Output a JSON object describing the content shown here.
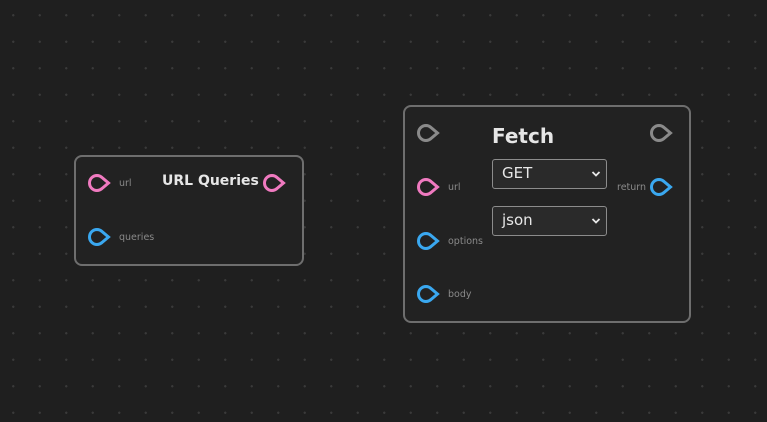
{
  "nodes": {
    "url_queries": {
      "title": "URL Queries",
      "inputs": {
        "url": "url",
        "queries": "queries"
      }
    },
    "fetch": {
      "title": "Fetch",
      "inputs": {
        "url": "url",
        "options": "options",
        "body": "body"
      },
      "outputs": {
        "return": "return"
      },
      "method": {
        "value": "GET"
      },
      "response_type": {
        "value": "json"
      }
    }
  },
  "colors": {
    "background": "#1f1f1f",
    "grid_dot": "#3a3a3a",
    "node_border": "#6e6e6e",
    "port_string": "#f07ac0",
    "port_object": "#3aa8f0",
    "port_exec": "#8a8a8a"
  },
  "icons": {
    "port": "socket-pin-icon",
    "select": "chevron-down-icon"
  }
}
